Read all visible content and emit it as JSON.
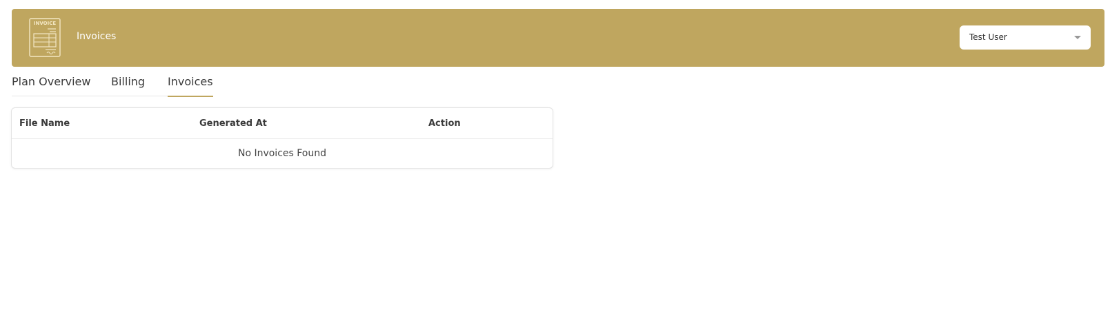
{
  "header": {
    "icon_text": "INVOICE",
    "title": "Invoices",
    "user_select_value": "Test User",
    "background_color": "#bfa65f"
  },
  "tabs": [
    {
      "label": "Plan Overview",
      "active": false
    },
    {
      "label": "Billing",
      "active": false
    },
    {
      "label": "Invoices",
      "active": true
    }
  ],
  "table": {
    "columns": [
      "File Name",
      "Generated At",
      "Action"
    ],
    "empty_message": "No Invoices Found"
  },
  "icons": {
    "header": "invoice-icon",
    "dropdown": "chevron-down-icon"
  },
  "colors": {
    "accent": "#bfa65f",
    "text": "#3a3a3a"
  }
}
